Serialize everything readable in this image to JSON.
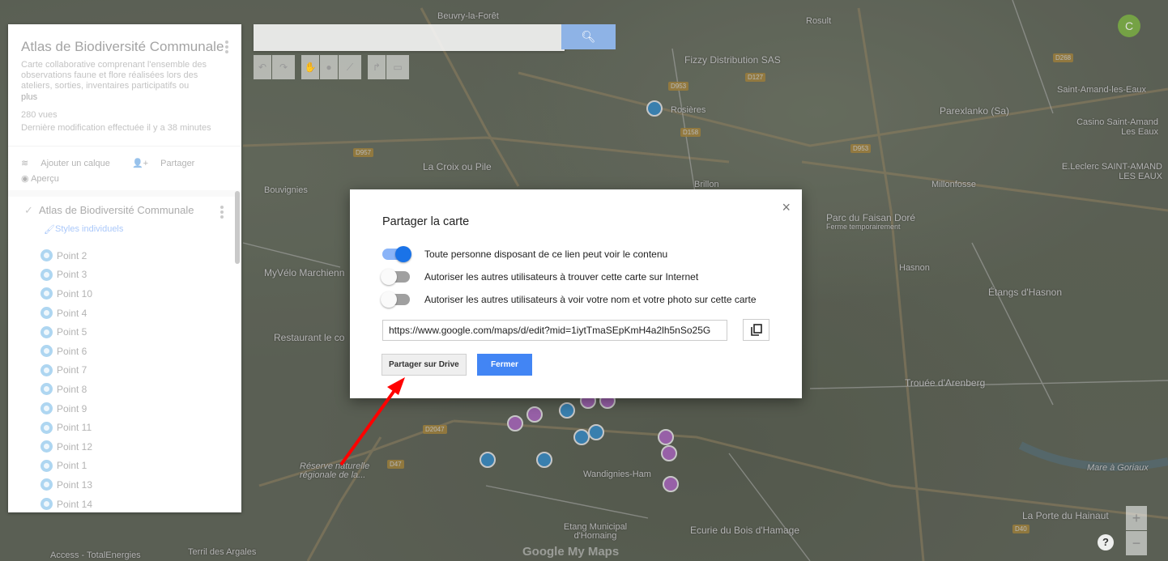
{
  "map": {
    "labels": {
      "beuvry": "Beuvry-la-Forêt",
      "rosult": "Rosult",
      "fizzy": "Fizzy Distribution SAS",
      "rosieres": "Rosières",
      "parexlanko": "Parexlanko (Sa)",
      "saint_amand": "Saint-Amand-les-Eaux",
      "casino": "Casino Saint-Amand Les Eaux",
      "leclerc": "E.Leclerc SAINT-AMAND LES EAUX",
      "croix": "La Croix ou Pile",
      "bouvignies": "Bouvignies",
      "brillon": "Brillon",
      "millonfosse": "Millonfosse",
      "parc": "Parc du Faisan Doré",
      "ferme": "Ferme temporairement",
      "hasnon": "Hasnon",
      "etangs": "Étangs d'Hasnon",
      "myvelo": "MyVélo Marchienn",
      "restaurant": "Restaurant le co",
      "trouee": "Trouée d'Arenberg",
      "reserve": "Réserve naturelle régionale de la...",
      "wandignies": "Wandignies-Ham",
      "etang_municipal": "Etang Municipal d'Hornaing",
      "ecurie": "Ecurie du Bois d'Hamage",
      "porte": "La Porte du Hainaut",
      "mare": "Mare à Goriaux",
      "access": "Access - TotalEnergies",
      "terril": "Terril des Argales",
      "logo": "Google My Maps"
    }
  },
  "panel": {
    "title": "Atlas de Biodiversité Communale",
    "description": "Carte collaborative comprenant l'ensemble des observations faune et flore réalisées lors des ateliers, sorties, inventaires participatifs ou",
    "more": "plus",
    "views": "280 vues",
    "modified": "Dernière modification effectuée il y a 38 minutes",
    "add_layer": "Ajouter un calque",
    "share": "Partager",
    "preview": "Aperçu",
    "layer_title": "Atlas de Biodiversité Communale",
    "styles": "Styles individuels",
    "points": [
      "Point 2",
      "Point 3",
      "Point 10",
      "Point 4",
      "Point 5",
      "Point 6",
      "Point 7",
      "Point 8",
      "Point 9",
      "Point 11",
      "Point 12",
      "Point 1",
      "Point 13",
      "Point 14"
    ]
  },
  "search": {
    "placeholder": ""
  },
  "avatar": {
    "initial": "C"
  },
  "dialog": {
    "title": "Partager la carte",
    "close": "×",
    "options": [
      {
        "label": "Toute personne disposant de ce lien peut voir le contenu",
        "on": true
      },
      {
        "label": "Autoriser les autres utilisateurs à trouver cette carte sur Internet",
        "on": false
      },
      {
        "label": "Autoriser les autres utilisateurs à voir votre nom et votre photo sur cette carte",
        "on": false
      }
    ],
    "url": "https://www.google.com/maps/d/edit?mid=1iytTmaSEpKmH4a2lh5nSo25G",
    "drive_button": "Partager sur Drive",
    "close_button": "Fermer"
  },
  "colors": {
    "accent": "#4285f4",
    "toggle_on": "#1a73e8",
    "arrow": "#ff0000"
  }
}
